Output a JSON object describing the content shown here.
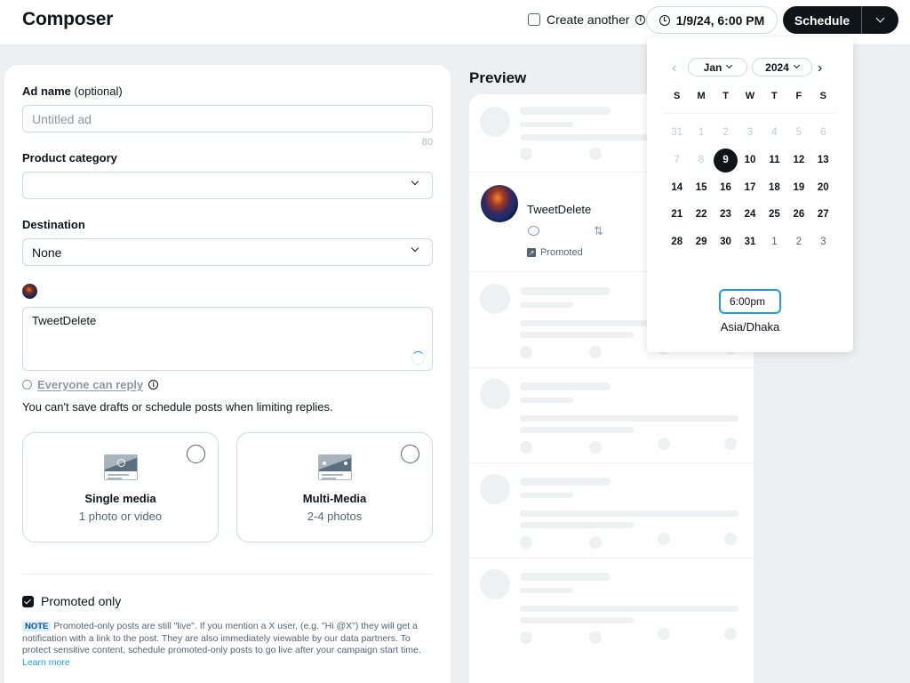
{
  "header": {
    "title": "Composer",
    "create_another_label": "Create another",
    "create_another_checked": false,
    "datetime_button": "1/9/24, 6:00 PM",
    "schedule_label": "Schedule"
  },
  "form": {
    "ad_name": {
      "label": "Ad name",
      "label_suffix": "(optional)",
      "value": "",
      "placeholder": "Untitled ad",
      "char_remaining": "80"
    },
    "product_category": {
      "label": "Product category",
      "value": ""
    },
    "destination": {
      "label": "Destination",
      "value": "None"
    },
    "post_text": "TweetDelete",
    "reply_setting": "Everyone can reply",
    "reply_warning": "You can't save drafts or schedule posts when limiting replies.",
    "media_options": [
      {
        "title": "Single media",
        "subtitle": "1 photo or video",
        "selected": false
      },
      {
        "title": "Multi-Media",
        "subtitle": "2-4 photos",
        "selected": false
      }
    ],
    "promoted_only": {
      "label": "Promoted only",
      "checked": true
    },
    "note": {
      "tag": "NOTE",
      "text": "Promoted-only posts are still \"live\". If you mention a X user, (e.g. \"Hi @X\") they will get a notification with a link to the post. They are also immediately viewable by our data partners. To protect sensitive content, schedule promoted-only posts to go live after your campaign start time.",
      "link": "Learn more"
    }
  },
  "preview": {
    "title": "Preview",
    "post": {
      "name": "TweetDelete",
      "promoted_label": "Promoted"
    }
  },
  "calendar": {
    "month": "Jan",
    "year": "2024",
    "weekdays": [
      "S",
      "M",
      "T",
      "W",
      "T",
      "F",
      "S"
    ],
    "days": [
      {
        "d": "31",
        "s": "muted"
      },
      {
        "d": "1",
        "s": "muted"
      },
      {
        "d": "2",
        "s": "muted"
      },
      {
        "d": "3",
        "s": "muted"
      },
      {
        "d": "4",
        "s": "muted"
      },
      {
        "d": "5",
        "s": "muted"
      },
      {
        "d": "6",
        "s": "muted"
      },
      {
        "d": "7",
        "s": "muted"
      },
      {
        "d": "8",
        "s": "muted"
      },
      {
        "d": "9",
        "s": "sel"
      },
      {
        "d": "10",
        "s": ""
      },
      {
        "d": "11",
        "s": ""
      },
      {
        "d": "12",
        "s": ""
      },
      {
        "d": "13",
        "s": ""
      },
      {
        "d": "14",
        "s": ""
      },
      {
        "d": "15",
        "s": ""
      },
      {
        "d": "16",
        "s": ""
      },
      {
        "d": "17",
        "s": ""
      },
      {
        "d": "18",
        "s": ""
      },
      {
        "d": "19",
        "s": ""
      },
      {
        "d": "20",
        "s": ""
      },
      {
        "d": "21",
        "s": ""
      },
      {
        "d": "22",
        "s": ""
      },
      {
        "d": "23",
        "s": ""
      },
      {
        "d": "24",
        "s": ""
      },
      {
        "d": "25",
        "s": ""
      },
      {
        "d": "26",
        "s": ""
      },
      {
        "d": "27",
        "s": ""
      },
      {
        "d": "28",
        "s": ""
      },
      {
        "d": "29",
        "s": ""
      },
      {
        "d": "30",
        "s": ""
      },
      {
        "d": "31",
        "s": ""
      },
      {
        "d": "1",
        "s": "next"
      },
      {
        "d": "2",
        "s": "next"
      },
      {
        "d": "3",
        "s": "next"
      }
    ],
    "time": "6:00pm",
    "timezone": "Asia/Dhaka"
  },
  "colors": {
    "accent": "#1d9bf0",
    "primary": "#0f1419",
    "muted": "#536471"
  }
}
